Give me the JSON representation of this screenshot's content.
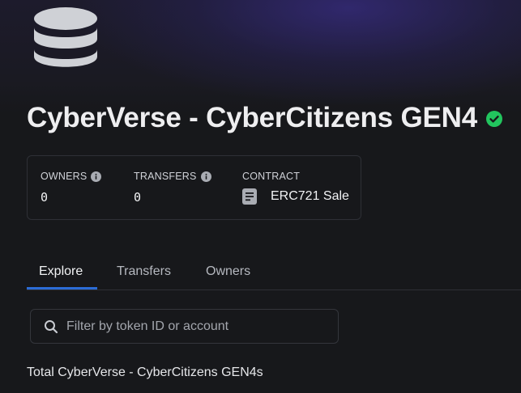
{
  "collection": {
    "title": "CyberVerse - CyberCitizens GEN4",
    "logo_icon": "database-stack-icon",
    "verified_icon": "verified-check-icon",
    "verified_color": "#22c55e"
  },
  "stats": {
    "owners_label": "OWNERS",
    "owners_value": "0",
    "transfers_label": "TRANSFERS",
    "transfers_value": "0",
    "contract_label": "CONTRACT",
    "contract_value": "ERC721 Sale",
    "contract_icon": "document-icon"
  },
  "tabs": [
    {
      "label": "Explore",
      "active": true
    },
    {
      "label": "Transfers",
      "active": false
    },
    {
      "label": "Owners",
      "active": false
    }
  ],
  "search": {
    "placeholder": "Filter by token ID or account",
    "value": ""
  },
  "total_text": "Total CyberVerse - CyberCitizens GEN4s",
  "colors": {
    "background": "#17181b",
    "accent": "#2b6cd6",
    "hero": "#342a78"
  }
}
